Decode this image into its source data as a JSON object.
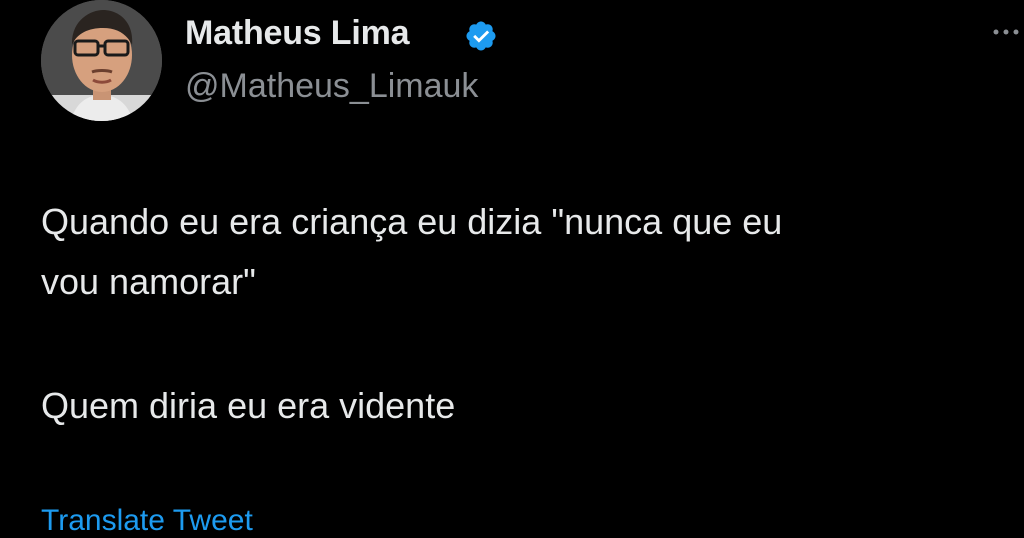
{
  "colors": {
    "background": "#000000",
    "text_primary": "#e7e9ea",
    "text_secondary": "#8b8f94",
    "accent": "#1d9bf0"
  },
  "author": {
    "display_name": "Matheus Lima",
    "handle": "@Matheus_Limauk",
    "verified_icon": "verified-badge-icon",
    "avatar_icon": "profile-photo"
  },
  "tweet": {
    "lines_paragraph_1": [
      "Quando eu era criança eu dizia \"nunca que eu",
      "vou namorar\""
    ],
    "lines_paragraph_2": [
      "Quem diria eu era vidente"
    ]
  },
  "actions": {
    "translate_label": "Translate Tweet",
    "more_icon": "more-options-icon"
  }
}
